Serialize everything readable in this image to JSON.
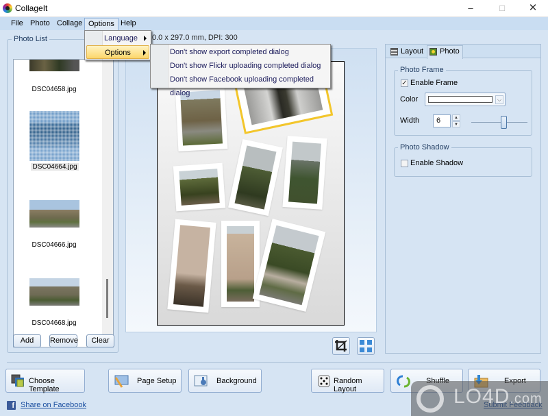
{
  "window": {
    "title": "CollageIt",
    "controls": {
      "minimize": "–",
      "maximize": "□",
      "close": "✕"
    }
  },
  "menubar": {
    "items": [
      "File",
      "Photo",
      "Collage",
      "Options",
      "Help"
    ],
    "active": "Options"
  },
  "options_menu": {
    "items": [
      {
        "label": "Language",
        "has_submenu": true
      },
      {
        "label": "Options",
        "has_submenu": true,
        "highlighted": true
      }
    ]
  },
  "options_submenu": {
    "items": [
      "Don't show export completed dialog",
      "Don't show Flickr uploading completed dialog",
      "Don't show Facebook uploading completed dialog"
    ]
  },
  "photo_list": {
    "label": "Photo List",
    "items": [
      {
        "name": "DSC04658.jpg",
        "selected": false
      },
      {
        "name": "DSC04664.jpg",
        "selected": true
      },
      {
        "name": "DSC04666.jpg",
        "selected": false
      },
      {
        "name": "DSC04668.jpg",
        "selected": false
      }
    ],
    "buttons": {
      "add": "Add",
      "remove": "Remove",
      "clear": "Clear"
    }
  },
  "canvas": {
    "page_info": "0.0 x 297.0 mm, DPI: 300",
    "tools": {
      "crop": "crop-icon",
      "fit": "fit-to-window-icon"
    }
  },
  "right_panel": {
    "tabs": [
      {
        "label": "Layout",
        "icon": "layout-icon",
        "active": false
      },
      {
        "label": "Photo",
        "icon": "photo-icon",
        "active": true
      }
    ],
    "photo_frame": {
      "group_label": "Photo Frame",
      "enable_frame_label": "Enable Frame",
      "enable_frame_checked": true,
      "color_label": "Color",
      "color_value": "#ffffff",
      "width_label": "Width",
      "width_value": "6",
      "width_slider_fraction": 0.55
    },
    "photo_shadow": {
      "group_label": "Photo Shadow",
      "enable_shadow_label": "Enable Shadow",
      "enable_shadow_checked": false
    }
  },
  "bottom": {
    "buttons": {
      "choose_template": "Choose Template",
      "page_setup": "Page Setup",
      "background": "Background",
      "random_layout": "Random Layout",
      "shuffle": "Shuffle",
      "export": "Export"
    },
    "share_facebook": "Share on Facebook",
    "submit_feedback": "Submit Feedback"
  },
  "watermark": {
    "text": "LO4D",
    "suffix": ".com"
  },
  "colors": {
    "window_bg": "#d6e4f3",
    "menubar_bg": "#c9ddf2",
    "selected_frame": "#f3c62b",
    "menu_highlight": "#fcd66b",
    "link": "#1b4fa0"
  }
}
